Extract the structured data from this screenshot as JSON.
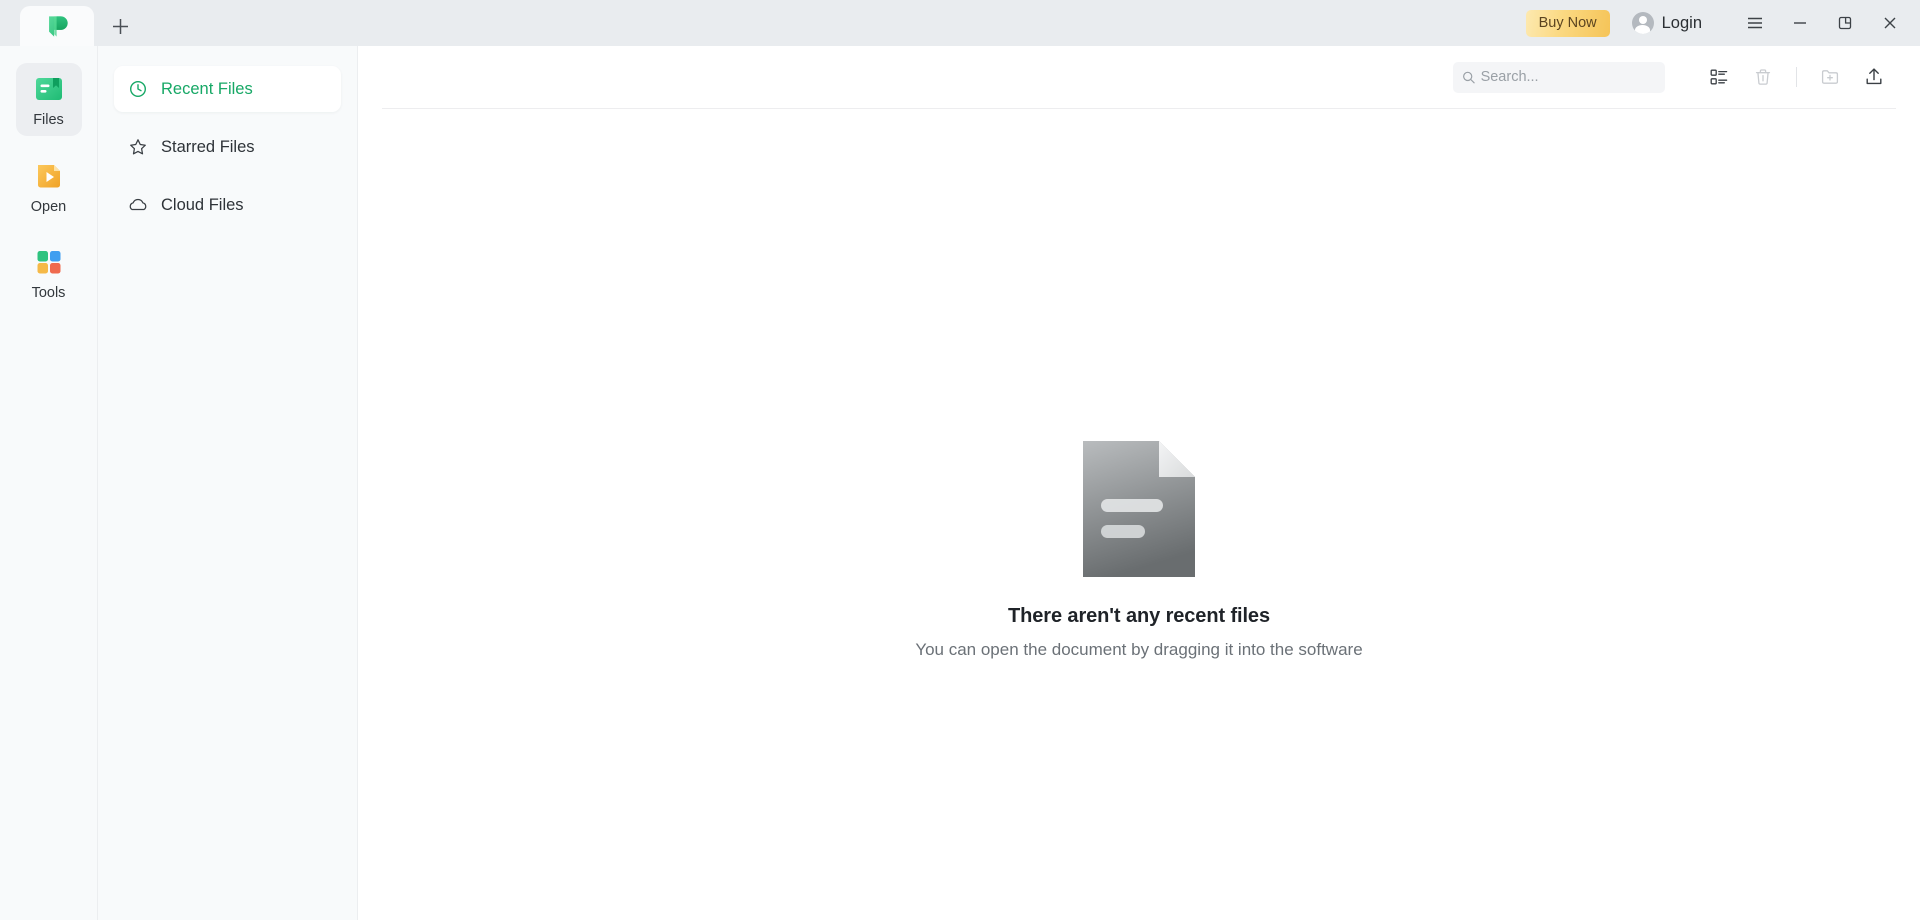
{
  "app": {
    "logo_icon": "app-logo-green-p",
    "accent_color": "#17a866",
    "titlebar_bg": "#e9ecef"
  },
  "titlebar": {
    "new_tab_label": "+",
    "new_tab_icon": "plus-icon",
    "buy_now_label": "Buy Now",
    "login_label": "Login",
    "avatar_icon": "user-avatar-icon",
    "menu_icon": "hamburger-menu-icon",
    "minimize_icon": "minimize-icon",
    "restore_icon": "restore-window-icon",
    "close_icon": "close-icon"
  },
  "rail": {
    "items": [
      {
        "label": "Files",
        "icon": "files-icon",
        "active": true
      },
      {
        "label": "Open",
        "icon": "open-icon",
        "active": false
      },
      {
        "label": "Tools",
        "icon": "tools-icon",
        "active": false
      }
    ]
  },
  "nav": {
    "items": [
      {
        "label": "Recent Files",
        "icon": "clock-icon",
        "active": true
      },
      {
        "label": "Starred Files",
        "icon": "star-icon",
        "active": false
      },
      {
        "label": "Cloud Files",
        "icon": "cloud-icon",
        "active": false
      }
    ]
  },
  "toolbar": {
    "search_placeholder": "Search...",
    "search_value": "",
    "search_icon": "search-icon",
    "list_view_icon": "list-view-icon",
    "delete_icon": "trash-icon",
    "new_folder_icon": "new-folder-icon",
    "upload_icon": "upload-icon"
  },
  "empty_state": {
    "icon": "document-placeholder-icon",
    "title": "There aren't any recent files",
    "subtitle": "You can open the document by dragging it into the software"
  }
}
